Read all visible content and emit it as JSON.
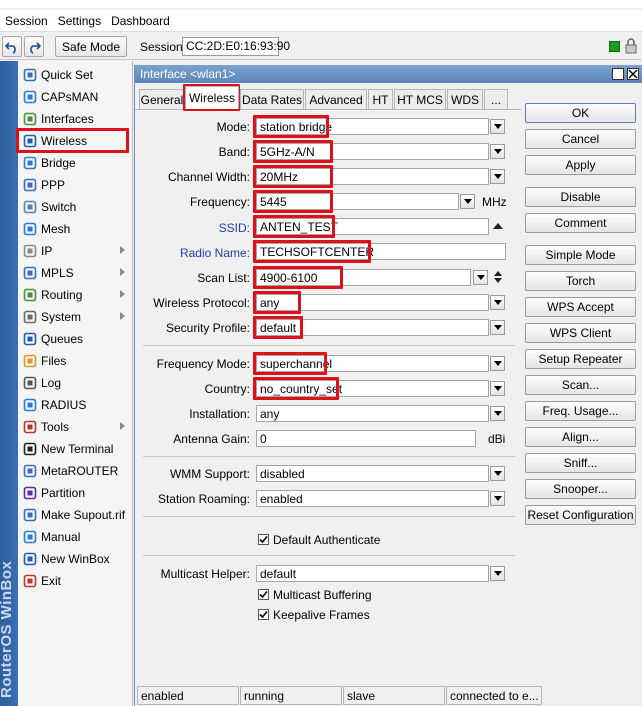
{
  "menu": {
    "items": [
      "Session",
      "Settings",
      "Dashboard"
    ]
  },
  "toolbar": {
    "safe_mode": "Safe Mode",
    "session_label": "Session:",
    "session_value": "CC:2D:E0:16:93:90"
  },
  "brand": {
    "vertical_text": "RouterOS WinBox"
  },
  "sidebar": {
    "items": [
      {
        "label": "Quick Set",
        "icon": "quick-set-icon"
      },
      {
        "label": "CAPsMAN",
        "icon": "capsman-icon"
      },
      {
        "label": "Interfaces",
        "icon": "interfaces-icon"
      },
      {
        "label": "Wireless",
        "icon": "wireless-icon"
      },
      {
        "label": "Bridge",
        "icon": "bridge-icon"
      },
      {
        "label": "PPP",
        "icon": "ppp-icon"
      },
      {
        "label": "Switch",
        "icon": "switch-icon"
      },
      {
        "label": "Mesh",
        "icon": "mesh-icon"
      },
      {
        "label": "IP",
        "icon": "ip-icon"
      },
      {
        "label": "MPLS",
        "icon": "mpls-icon"
      },
      {
        "label": "Routing",
        "icon": "routing-icon"
      },
      {
        "label": "System",
        "icon": "system-icon"
      },
      {
        "label": "Queues",
        "icon": "queues-icon"
      },
      {
        "label": "Files",
        "icon": "files-icon"
      },
      {
        "label": "Log",
        "icon": "log-icon"
      },
      {
        "label": "RADIUS",
        "icon": "radius-icon"
      },
      {
        "label": "Tools",
        "icon": "tools-icon"
      },
      {
        "label": "New Terminal",
        "icon": "terminal-icon"
      },
      {
        "label": "MetaROUTER",
        "icon": "metarouter-icon"
      },
      {
        "label": "Partition",
        "icon": "partition-icon"
      },
      {
        "label": "Make Supout.rif",
        "icon": "supout-icon"
      },
      {
        "label": "Manual",
        "icon": "manual-icon"
      },
      {
        "label": "New WinBox",
        "icon": "winbox-icon"
      },
      {
        "label": "Exit",
        "icon": "exit-icon"
      }
    ]
  },
  "window": {
    "title": "Interface <wlan1>",
    "tabs": [
      "General",
      "Wireless",
      "Data Rates",
      "Advanced",
      "HT",
      "HT MCS",
      "WDS",
      "..."
    ],
    "active_tab": "Wireless"
  },
  "form": {
    "mode": {
      "label": "Mode:",
      "value": "station bridge"
    },
    "band": {
      "label": "Band:",
      "value": "5GHz-A/N"
    },
    "channel_width": {
      "label": "Channel Width:",
      "value": "20MHz"
    },
    "frequency": {
      "label": "Frequency:",
      "value": "5445",
      "unit": "MHz"
    },
    "ssid": {
      "label": "SSID:",
      "value": "ANTEN_TEST"
    },
    "radio_name": {
      "label": "Radio Name:",
      "value": "TECHSOFTCENTER"
    },
    "scan_list": {
      "label": "Scan List:",
      "value": "4900-6100"
    },
    "wireless_protocol": {
      "label": "Wireless Protocol:",
      "value": "any"
    },
    "security_profile": {
      "label": "Security Profile:",
      "value": "default"
    },
    "frequency_mode": {
      "label": "Frequency Mode:",
      "value": "superchannel"
    },
    "country": {
      "label": "Country:",
      "value": "no_country_set"
    },
    "installation": {
      "label": "Installation:",
      "value": "any"
    },
    "antenna_gain": {
      "label": "Antenna Gain:",
      "value": "0",
      "unit": "dBi"
    },
    "wmm_support": {
      "label": "WMM Support:",
      "value": "disabled"
    },
    "station_roaming": {
      "label": "Station Roaming:",
      "value": "enabled"
    },
    "default_authenticate": {
      "label": "Default Authenticate",
      "checked": true
    },
    "multicast_helper": {
      "label": "Multicast Helper:",
      "value": "default"
    },
    "multicast_buffering": {
      "label": "Multicast Buffering",
      "checked": true
    },
    "keepalive_frames": {
      "label": "Keepalive Frames",
      "checked": true
    }
  },
  "buttons": [
    "OK",
    "Cancel",
    "Apply",
    "Disable",
    "Comment",
    "Simple Mode",
    "Torch",
    "WPS Accept",
    "WPS Client",
    "Setup Repeater",
    "Scan...",
    "Freq. Usage...",
    "Align...",
    "Sniff...",
    "Snooper...",
    "Reset Configuration"
  ],
  "status": [
    "enabled",
    "running",
    "slave",
    "connected to e..."
  ],
  "colors": {
    "highlight": "#e0101a",
    "title_bar": "#5c86bd",
    "brand": "#3a70b5",
    "label_blue": "#1e3fa8"
  }
}
